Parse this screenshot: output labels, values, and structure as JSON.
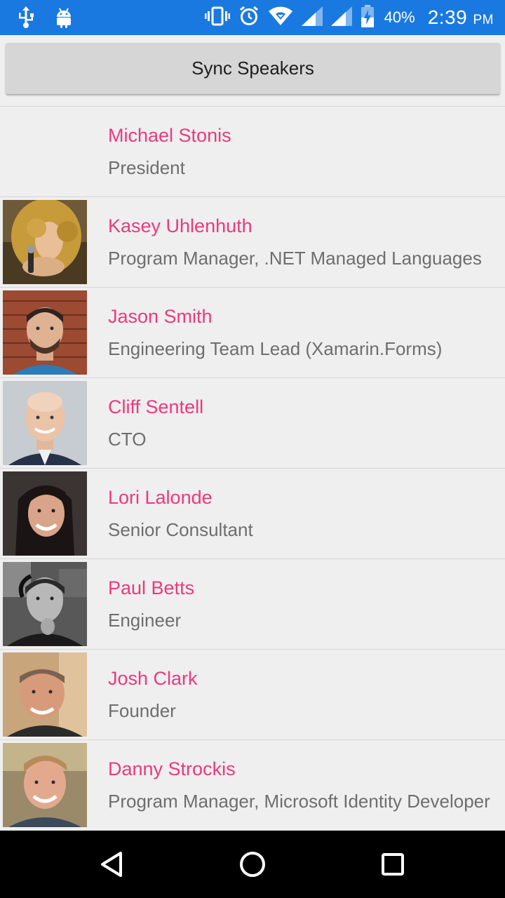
{
  "status_bar": {
    "battery_percent": "40%",
    "time": "2:39",
    "ampm": "PM",
    "icons": [
      "usb-icon",
      "android-icon",
      "vibrate-icon",
      "alarm-icon",
      "wifi-icon",
      "signal-icon",
      "signal-icon",
      "battery-icon"
    ]
  },
  "toolbar": {
    "sync_label": "Sync Speakers"
  },
  "colors": {
    "status_bar": "#1a79e0",
    "accent_name": "#e93a7f",
    "title_text": "#6e6e6e",
    "background": "#efefef",
    "button": "#d6d6d6"
  },
  "speakers": [
    {
      "name": "Michael Stonis",
      "title": "President",
      "has_photo": false
    },
    {
      "name": "Kasey Uhlenhuth",
      "title": "Program Manager, .NET Managed Languages",
      "has_photo": true
    },
    {
      "name": "Jason Smith",
      "title": "Engineering Team Lead (Xamarin.Forms)",
      "has_photo": true
    },
    {
      "name": "Cliff Sentell",
      "title": "CTO",
      "has_photo": true
    },
    {
      "name": "Lori Lalonde",
      "title": "Senior Consultant",
      "has_photo": true
    },
    {
      "name": "Paul Betts",
      "title": "Engineer",
      "has_photo": true
    },
    {
      "name": "Josh Clark",
      "title": "Founder",
      "has_photo": true
    },
    {
      "name": "Danny Strockis",
      "title": "Program Manager, Microsoft Identity Developer",
      "has_photo": true
    }
  ],
  "nav": {
    "icons": [
      "back-icon",
      "home-icon",
      "recents-icon"
    ]
  }
}
